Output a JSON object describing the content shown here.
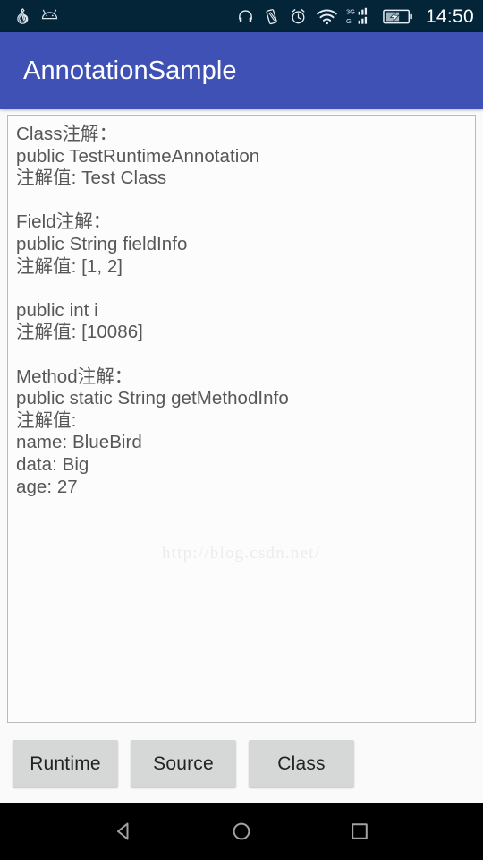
{
  "status_bar": {
    "background_color": "#042438",
    "clock": "14:50",
    "left_icons": [
      {
        "name": "netease-music-icon",
        "label": "NetEase Cloud Music notification"
      },
      {
        "name": "android-head-icon",
        "label": "Android system notification"
      }
    ],
    "right_icons": [
      {
        "name": "headphones-icon",
        "label": "Headset connected"
      },
      {
        "name": "vibrate-icon",
        "label": "Vibrate mode"
      },
      {
        "name": "alarm-icon",
        "label": "Alarm set"
      },
      {
        "name": "wifi-icon",
        "label": "Wi-Fi signal"
      },
      {
        "name": "mobile-signal-3g-icon",
        "label": "3G / G dual SIM signal"
      },
      {
        "name": "battery-charging-icon",
        "label": "Battery charging"
      }
    ],
    "signal_labels": {
      "top": "3G",
      "bottom": "G"
    }
  },
  "app_bar": {
    "title": "AnnotationSample",
    "background_color": "#3f51b5",
    "text_color": "#ffffff"
  },
  "content": {
    "text": "Class注解：\npublic TestRuntimeAnnotation\n注解值: Test Class\n\nField注解：\npublic String fieldInfo\n注解值: [1, 2]\n\npublic int i\n注解值: [10086]\n\nMethod注解：\npublic static String getMethodInfo\n注解值:\nname: BlueBird\ndata: Big\nage: 27",
    "text_color": "#575757",
    "background_color": "#fcfcfc",
    "border_color": "#b9b9b9",
    "sections": [
      {
        "heading": "Class注解：",
        "signature": "public TestRuntimeAnnotation",
        "values": [
          "注解值: Test Class"
        ]
      },
      {
        "heading": "Field注解：",
        "signature": "public String fieldInfo",
        "values": [
          "注解值: [1, 2]"
        ]
      },
      {
        "heading": "",
        "signature": "public int i",
        "values": [
          "注解值: [10086]"
        ]
      },
      {
        "heading": "Method注解：",
        "signature": "public static String getMethodInfo",
        "values": [
          "注解值:",
          "name: BlueBird",
          "data: Big",
          "age: 27"
        ]
      }
    ]
  },
  "watermark": {
    "text": "http://blog.csdn.net/",
    "color": "#ececec"
  },
  "buttons": [
    {
      "name": "runtime-button",
      "label": "Runtime"
    },
    {
      "name": "source-button",
      "label": "Source"
    },
    {
      "name": "class-button",
      "label": "Class"
    }
  ],
  "nav_bar": {
    "background_color": "#000000",
    "items": [
      {
        "name": "back-icon",
        "label": "Back"
      },
      {
        "name": "home-icon",
        "label": "Home"
      },
      {
        "name": "recents-icon",
        "label": "Recent apps"
      }
    ]
  }
}
